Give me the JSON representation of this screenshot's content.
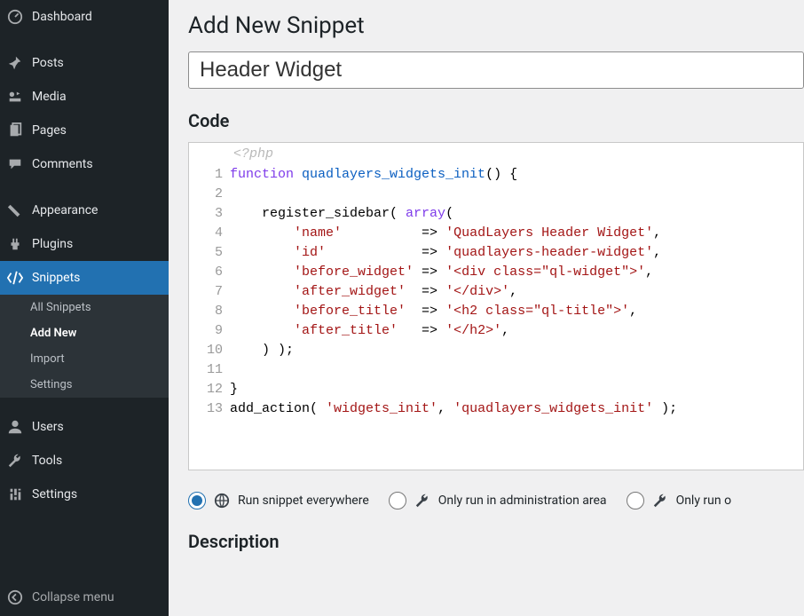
{
  "sidebar": {
    "items": [
      {
        "label": "Dashboard",
        "icon": "dashboard"
      },
      {
        "label": "Posts",
        "icon": "pin"
      },
      {
        "label": "Media",
        "icon": "media"
      },
      {
        "label": "Pages",
        "icon": "pages"
      },
      {
        "label": "Comments",
        "icon": "comments"
      },
      {
        "label": "Appearance",
        "icon": "appearance"
      },
      {
        "label": "Plugins",
        "icon": "plugins"
      },
      {
        "label": "Snippets",
        "icon": "snippets"
      },
      {
        "label": "Users",
        "icon": "users"
      },
      {
        "label": "Tools",
        "icon": "tools"
      },
      {
        "label": "Settings",
        "icon": "settings"
      }
    ],
    "submenu": [
      {
        "label": "All Snippets"
      },
      {
        "label": "Add New",
        "current": true
      },
      {
        "label": "Import"
      },
      {
        "label": "Settings"
      }
    ],
    "collapse": "Collapse menu"
  },
  "page": {
    "title": "Add New Snippet",
    "snippet_title": "Header Widget",
    "code_heading": "Code",
    "php_open": "<?php",
    "description_heading": "Description"
  },
  "scope": {
    "options": [
      {
        "label": "Run snippet everywhere",
        "checked": true,
        "icon": "globe"
      },
      {
        "label": "Only run in administration area",
        "checked": false,
        "icon": "wrench"
      },
      {
        "label": "Only run o",
        "checked": false,
        "icon": "wrench"
      }
    ]
  },
  "code_lines": [
    [
      {
        "t": "kw",
        "s": "function "
      },
      {
        "t": "fn",
        "s": "quadlayers_widgets_init"
      },
      {
        "t": "plain",
        "s": "() {"
      }
    ],
    [],
    [
      {
        "t": "plain",
        "s": "    register_sidebar( "
      },
      {
        "t": "kw",
        "s": "array"
      },
      {
        "t": "plain",
        "s": "("
      }
    ],
    [
      {
        "t": "plain",
        "s": "        "
      },
      {
        "t": "str",
        "s": "'name'"
      },
      {
        "t": "plain",
        "s": "          => "
      },
      {
        "t": "str",
        "s": "'QuadLayers Header Widget'"
      },
      {
        "t": "plain",
        "s": ","
      }
    ],
    [
      {
        "t": "plain",
        "s": "        "
      },
      {
        "t": "str",
        "s": "'id'"
      },
      {
        "t": "plain",
        "s": "            => "
      },
      {
        "t": "str",
        "s": "'quadlayers-header-widget'"
      },
      {
        "t": "plain",
        "s": ","
      }
    ],
    [
      {
        "t": "plain",
        "s": "        "
      },
      {
        "t": "str",
        "s": "'before_widget'"
      },
      {
        "t": "plain",
        "s": " => "
      },
      {
        "t": "str",
        "s": "'<div class=\"ql-widget\">'"
      },
      {
        "t": "plain",
        "s": ","
      }
    ],
    [
      {
        "t": "plain",
        "s": "        "
      },
      {
        "t": "str",
        "s": "'after_widget'"
      },
      {
        "t": "plain",
        "s": "  => "
      },
      {
        "t": "str",
        "s": "'</div>'"
      },
      {
        "t": "plain",
        "s": ","
      }
    ],
    [
      {
        "t": "plain",
        "s": "        "
      },
      {
        "t": "str",
        "s": "'before_title'"
      },
      {
        "t": "plain",
        "s": "  => "
      },
      {
        "t": "str",
        "s": "'<h2 class=\"ql-title\">'"
      },
      {
        "t": "plain",
        "s": ","
      }
    ],
    [
      {
        "t": "plain",
        "s": "        "
      },
      {
        "t": "str",
        "s": "'after_title'"
      },
      {
        "t": "plain",
        "s": "   => "
      },
      {
        "t": "str",
        "s": "'</h2>'"
      },
      {
        "t": "plain",
        "s": ","
      }
    ],
    [
      {
        "t": "plain",
        "s": "    ) );"
      }
    ],
    [],
    [
      {
        "t": "plain",
        "s": "}"
      }
    ],
    [
      {
        "t": "plain",
        "s": "add_action( "
      },
      {
        "t": "str",
        "s": "'widgets_init'"
      },
      {
        "t": "plain",
        "s": ", "
      },
      {
        "t": "str",
        "s": "'quadlayers_widgets_init'"
      },
      {
        "t": "plain",
        "s": " );"
      }
    ]
  ]
}
